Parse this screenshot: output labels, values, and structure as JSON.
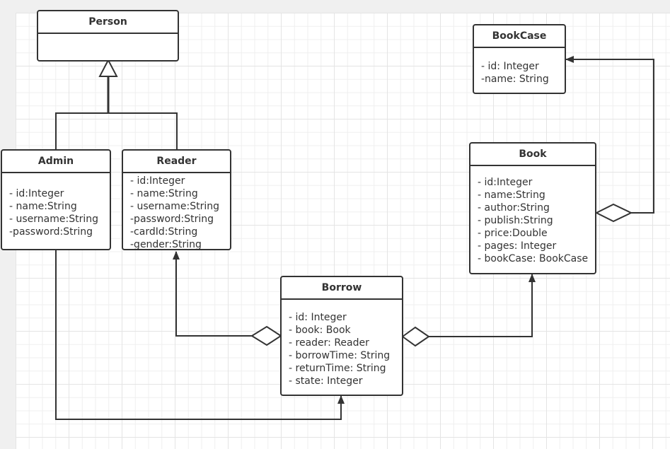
{
  "diagram": {
    "type": "UML class diagram",
    "classes": {
      "person": {
        "name": "Person",
        "attributes": []
      },
      "admin": {
        "name": "Admin",
        "attributes": [
          "- id:Integer",
          "- name:String",
          "- username:String",
          "-password:String"
        ]
      },
      "reader": {
        "name": "Reader",
        "attributes": [
          "- id:Integer",
          "- name:String",
          "- username:String",
          "-password:String",
          "-cardId:String",
          "-gender:String"
        ]
      },
      "borrow": {
        "name": "Borrow",
        "attributes": [
          "- id: Integer",
          "- book: Book",
          "- reader: Reader",
          "- borrowTime: String",
          "- returnTime: String",
          "- state: Integer"
        ]
      },
      "bookcase": {
        "name": "BookCase",
        "attributes": [
          "- id: Integer",
          "-name: String"
        ]
      },
      "book": {
        "name": "Book",
        "attributes": [
          "- id:Integer",
          "- name:String",
          "- author:String",
          "- publish:String",
          "- price:Double",
          "- pages: Integer",
          "- bookCase: BookCase"
        ]
      }
    },
    "relationships": [
      {
        "type": "generalization",
        "from": "Admin",
        "to": "Person"
      },
      {
        "type": "generalization",
        "from": "Reader",
        "to": "Person"
      },
      {
        "type": "aggregation",
        "whole": "Borrow",
        "part": "Reader"
      },
      {
        "type": "aggregation",
        "whole": "Borrow",
        "part": "Book"
      },
      {
        "type": "aggregation",
        "whole": "Book",
        "part": "BookCase"
      },
      {
        "type": "association",
        "from": "Admin",
        "to": "Borrow"
      }
    ]
  }
}
